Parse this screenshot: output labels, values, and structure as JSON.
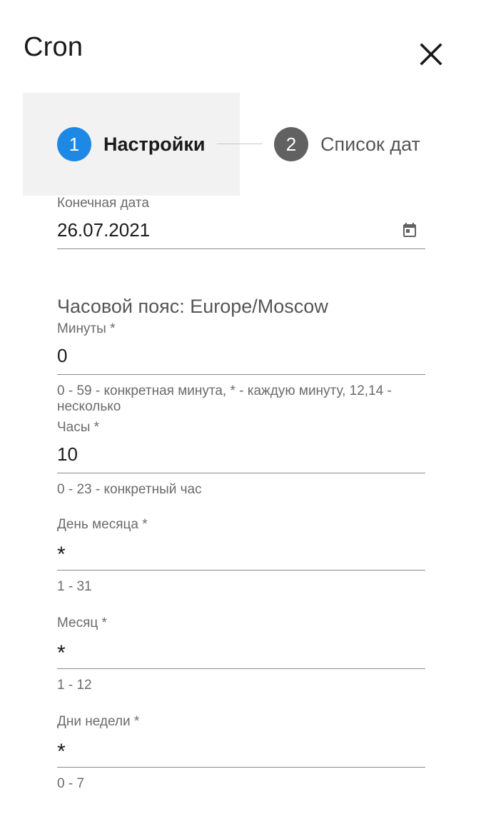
{
  "dialog": {
    "title": "Cron"
  },
  "stepper": {
    "steps": [
      {
        "number": "1",
        "label": "Настройки",
        "color": "#1e88e5",
        "active": true
      },
      {
        "number": "2",
        "label": "Список дат",
        "color": "#616161",
        "active": false
      }
    ]
  },
  "form": {
    "end_date": {
      "label": "Конечная дата",
      "value": "26.07.2021",
      "icon": "calendar-icon"
    },
    "timezone": "Часовой пояс: Europe/Moscow",
    "minutes": {
      "label": "Минуты *",
      "value": "0",
      "hint": "0 - 59 - конкретная минута, * - каждую минуту, 12,14 - несколько"
    },
    "hours": {
      "label": "Часы *",
      "value": "10",
      "hint": "0 - 23 - конкретный час"
    },
    "day_of_month": {
      "label": "День месяца *",
      "value": "*",
      "hint": "1 - 31"
    },
    "month": {
      "label": "Месяц *",
      "value": "*",
      "hint": "1 - 12"
    },
    "weekdays": {
      "label": "Дни недели *",
      "value": "*",
      "hint": "0 - 7"
    }
  }
}
